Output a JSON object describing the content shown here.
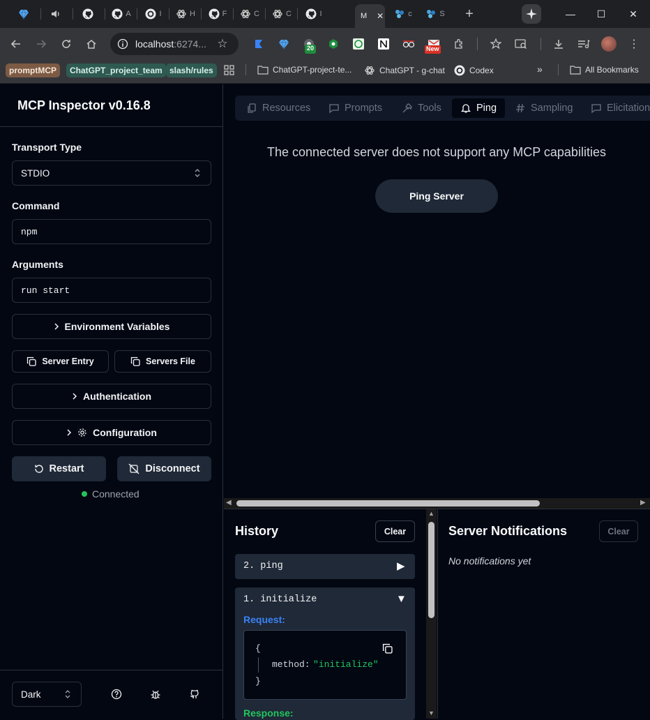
{
  "browser": {
    "tabs": [
      {
        "icon": "gem-icon",
        "text": ""
      },
      {
        "icon": "speaker-icon",
        "text": ""
      },
      {
        "icon": "github-icon",
        "text": ""
      },
      {
        "icon": "github-icon",
        "text": "A"
      },
      {
        "icon": "circle-g-icon",
        "text": "I"
      },
      {
        "icon": "openai-icon",
        "text": "H"
      },
      {
        "icon": "github-icon",
        "text": "F"
      },
      {
        "icon": "openai-icon",
        "text": "C"
      },
      {
        "icon": "openai-icon",
        "text": "C"
      },
      {
        "icon": "github-icon",
        "text": "I"
      }
    ],
    "active_tab": {
      "text": "M",
      "close": "✕"
    },
    "after_tabs": [
      {
        "icon": "gear-cluster-icon",
        "text": "c"
      },
      {
        "icon": "gear-cluster-icon",
        "text": "S"
      }
    ],
    "new_tab": "+",
    "window_controls": {
      "minimize": "—",
      "maximize": "☐",
      "close": "✕"
    },
    "url": {
      "host": "localhost",
      "rest": ":6274..."
    },
    "ext_badges": {
      "count": "20",
      "new": "New"
    },
    "bookmarks": [
      {
        "label": "promptMCP",
        "bg": "#7c5a44",
        "color": "#f5e6d8"
      },
      {
        "label": "ChatGPT_project_team",
        "bg": "#2e5a52",
        "color": "#d6f0e8"
      },
      {
        "label": "slash/rules",
        "bg": "#2e5a52",
        "color": "#d6f0e8"
      }
    ],
    "bookmark_folders": [
      {
        "label": "ChatGPT-project-te...",
        "icon": "folder-icon"
      },
      {
        "label": "ChatGPT - g-chat",
        "icon": "openai-icon"
      },
      {
        "label": "Codex",
        "icon": "circle-g-icon"
      }
    ],
    "more": "»",
    "all_bookmarks": "All Bookmarks"
  },
  "sidebar": {
    "title": "MCP Inspector v0.16.8",
    "transport_label": "Transport Type",
    "transport_value": "STDIO",
    "command_label": "Command",
    "command_value": "npm",
    "arguments_label": "Arguments",
    "arguments_value": "run start",
    "env_button": "Environment Variables",
    "server_entry": "Server Entry",
    "servers_file": "Servers File",
    "auth_button": "Authentication",
    "config_button": "Configuration",
    "restart": "Restart",
    "disconnect": "Disconnect",
    "status": "Connected",
    "status_color": "#22c55e",
    "theme": "Dark"
  },
  "main": {
    "tabs": [
      {
        "label": "Resources",
        "icon": "files-icon"
      },
      {
        "label": "Prompts",
        "icon": "message-square-icon"
      },
      {
        "label": "Tools",
        "icon": "hammer-icon"
      },
      {
        "label": "Ping",
        "icon": "bell-icon",
        "active": true
      },
      {
        "label": "Sampling",
        "icon": "hash-icon"
      },
      {
        "label": "Elicitation",
        "icon": "message-square-icon"
      }
    ],
    "message": "The connected server does not support any MCP capabilities",
    "ping_button": "Ping Server"
  },
  "history": {
    "title": "History",
    "clear": "Clear",
    "items": [
      {
        "label": "2. ping",
        "toggle": "▶"
      },
      {
        "label": "1. initialize",
        "toggle": "▼"
      }
    ],
    "request_label": "Request:",
    "json_open": "{",
    "json_key": "method:",
    "json_value": "\"initialize\"",
    "json_close": "}",
    "response_label": "Response:"
  },
  "notifications": {
    "title": "Server Notifications",
    "clear": "Clear",
    "empty": "No notifications yet"
  },
  "colors": {
    "accent_blue": "#3b82f6",
    "accent_green": "#22c55e",
    "json_string": "#22c55e"
  }
}
